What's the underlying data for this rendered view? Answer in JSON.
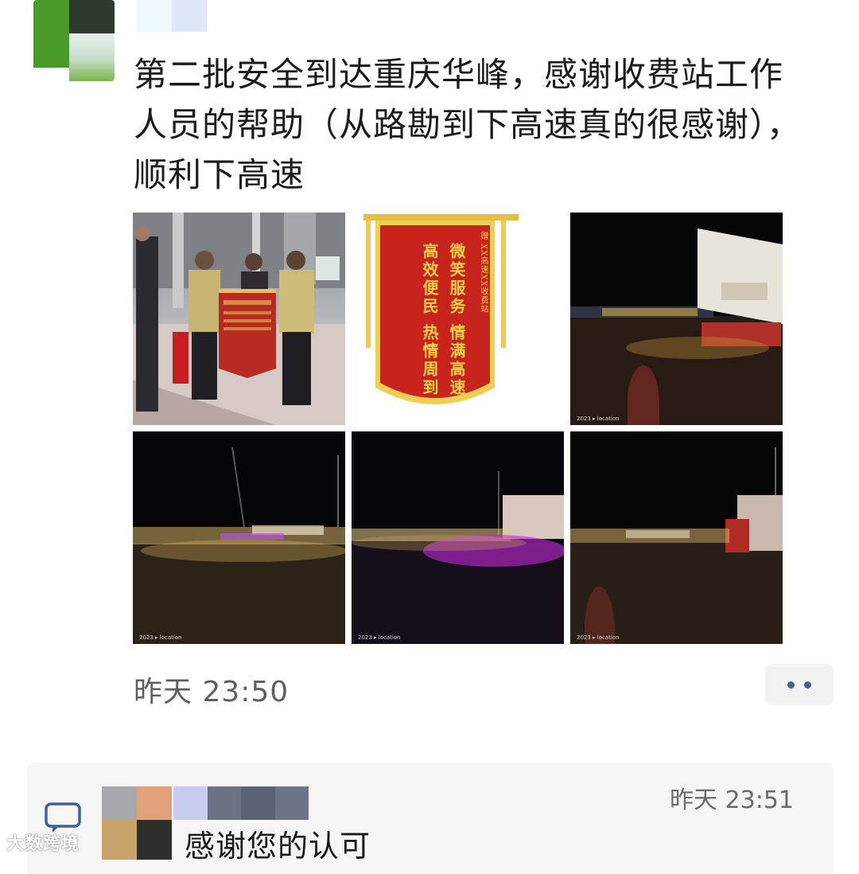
{
  "post": {
    "text": "第二批安全到达重庆华峰，感谢收费站工作人员的帮助（从路勘到下高速真的很感谢），顺利下高速",
    "time": "昨天 23:50"
  },
  "pennant": {
    "left_line": "高效便民 热情周到",
    "right_line": "微笑服务 情满高速",
    "header": "赠 XX高速XX收费站"
  },
  "photo_stamp": "2023 ▸ location",
  "comment": {
    "time": "昨天 23:51",
    "text": "感谢您的认可"
  },
  "watermark": "大数跨境",
  "colors": {
    "link_dots": "#45608c",
    "pennant_red": "#c8241e",
    "pennant_gold": "#f4d04a"
  },
  "icons": [
    "comment-icon",
    "more-icon"
  ]
}
